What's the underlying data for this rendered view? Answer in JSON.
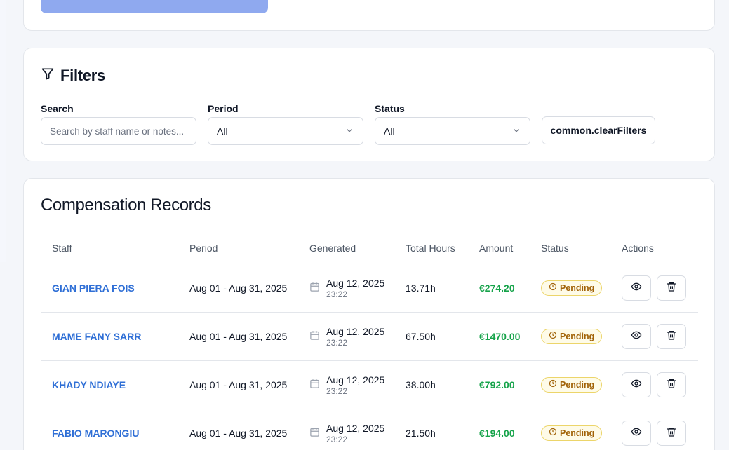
{
  "filters": {
    "title": "Filters",
    "search": {
      "label": "Search",
      "placeholder": "Search by staff name or notes..."
    },
    "period": {
      "label": "Period",
      "value": "All"
    },
    "status": {
      "label": "Status",
      "value": "All"
    },
    "clear_label": "common.clearFilters"
  },
  "records": {
    "title": "Compensation Records",
    "columns": [
      "Staff",
      "Period",
      "Generated",
      "Total Hours",
      "Amount",
      "Status",
      "Actions"
    ],
    "rows": [
      {
        "staff": "GIAN PIERA FOIS",
        "period": "Aug 01 - Aug 31, 2025",
        "gen_date": "Aug 12, 2025",
        "gen_time": "23:22",
        "hours": "13.71h",
        "amount": "€274.20",
        "status": "Pending"
      },
      {
        "staff": "MAME FANY SARR",
        "period": "Aug 01 - Aug 31, 2025",
        "gen_date": "Aug 12, 2025",
        "gen_time": "23:22",
        "hours": "67.50h",
        "amount": "€1470.00",
        "status": "Pending"
      },
      {
        "staff": "KHADY NDIAYE",
        "period": "Aug 01 - Aug 31, 2025",
        "gen_date": "Aug 12, 2025",
        "gen_time": "23:22",
        "hours": "38.00h",
        "amount": "€792.00",
        "status": "Pending"
      },
      {
        "staff": "FABIO MARONGIU",
        "period": "Aug 01 - Aug 31, 2025",
        "gen_date": "Aug 12, 2025",
        "gen_time": "23:22",
        "hours": "21.50h",
        "amount": "€194.00",
        "status": "Pending"
      }
    ]
  },
  "colors": {
    "accent": "#2f6fd6",
    "amount": "#16a34a",
    "pending_bg": "#fefbe8",
    "pending_text": "#a16207",
    "top_button": "#8fa9ef"
  },
  "icons": {
    "filter": "filter-icon",
    "chevron": "chevron-down-icon",
    "calendar": "calendar-icon",
    "clock": "clock-icon",
    "view": "eye-icon",
    "delete": "trash-icon"
  }
}
